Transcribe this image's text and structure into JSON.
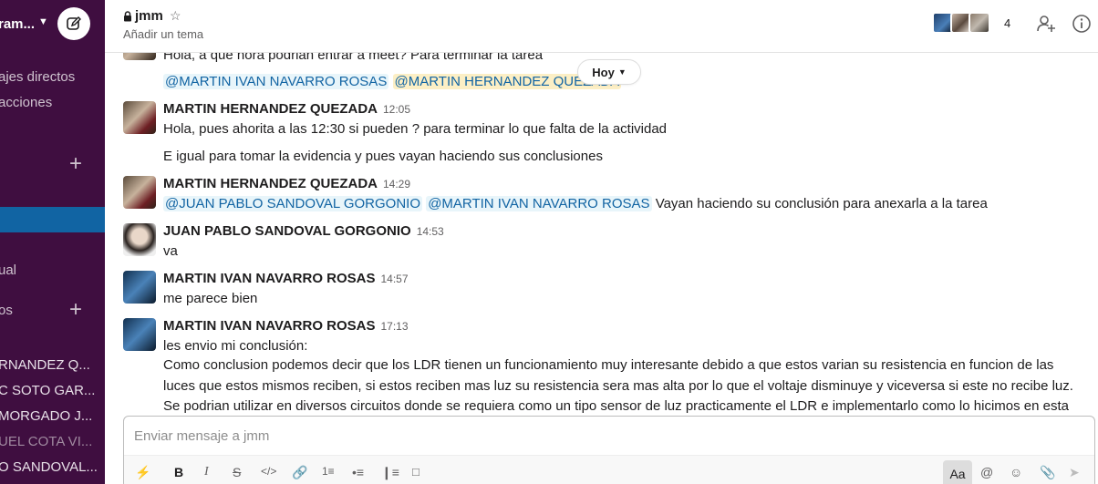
{
  "sidebar": {
    "workspace_name": "ram...",
    "items": [
      {
        "label": "ajes directos"
      },
      {
        "label": "acciones"
      },
      {
        "label": "ual"
      },
      {
        "label": "os"
      }
    ],
    "dms": [
      {
        "label": "RNANDEZ Q..."
      },
      {
        "label": "C SOTO GAR..."
      },
      {
        "label": "MORGADO J..."
      },
      {
        "label": "UEL COTA VI..."
      },
      {
        "label": "O SANDOVAL..."
      }
    ]
  },
  "header": {
    "channel_name": "jmm",
    "topic": "Añadir un tema",
    "member_count": "4"
  },
  "messages": {
    "partial_text": "Hola, a que hora podrian entrar a meet? Para terminar la tarea",
    "day_label": "Hoy",
    "partial_mentions": [
      "@MARTIN IVAN NAVARRO ROSAS",
      "@MARTIN HERNANDEZ QUEZADA"
    ],
    "list": [
      {
        "author": "MARTIN HERNANDEZ QUEZADA",
        "time": "12:05",
        "line1": "Hola, pues ahorita a las 12:30 si pueden ? para terminar lo que falta de la actividad",
        "line2": "E igual para tomar la evidencia y pues vayan haciendo sus conclusiones"
      },
      {
        "author": "MARTIN HERNANDEZ QUEZADA",
        "time": "14:29",
        "mention1": "@JUAN PABLO SANDOVAL GORGONIO",
        "mention2": "@MARTIN IVAN NAVARRO ROSAS",
        "text": "Vayan haciendo su conclusión para anexarla a la tarea"
      },
      {
        "author": "JUAN PABLO SANDOVAL GORGONIO",
        "time": "14:53",
        "text": "va"
      },
      {
        "author": "MARTIN IVAN NAVARRO ROSAS",
        "time": "14:57",
        "text": "me parece bien"
      },
      {
        "author": "MARTIN IVAN NAVARRO ROSAS",
        "time": "17:13",
        "line1": "les envio mi conclusión:",
        "body": "Como conclusion podemos decir que los LDR tienen un funcionamiento muy interesante debido a que estos varian su resistencia en funcion de las luces que estos mismos reciben, si estos reciben mas luz su resistencia sera mas alta por lo que el voltaje disminuye y viceversa si este no recibe luz. Se podrian utilizar en diversos circuitos donde se requiera como un tipo sensor de luz practicamente el LDR e implementarlo como lo hicimos en esta practica."
      }
    ]
  },
  "composer": {
    "placeholder": "Enviar mensaje a jmm",
    "format_label": "Aa"
  },
  "colors": {
    "sidebar_bg": "#3f0e40",
    "active_item": "#1164a3",
    "mention_bg": "#e8f5fa",
    "mention_self_bg": "#fcefc5",
    "mention_text": "#1264a3"
  }
}
